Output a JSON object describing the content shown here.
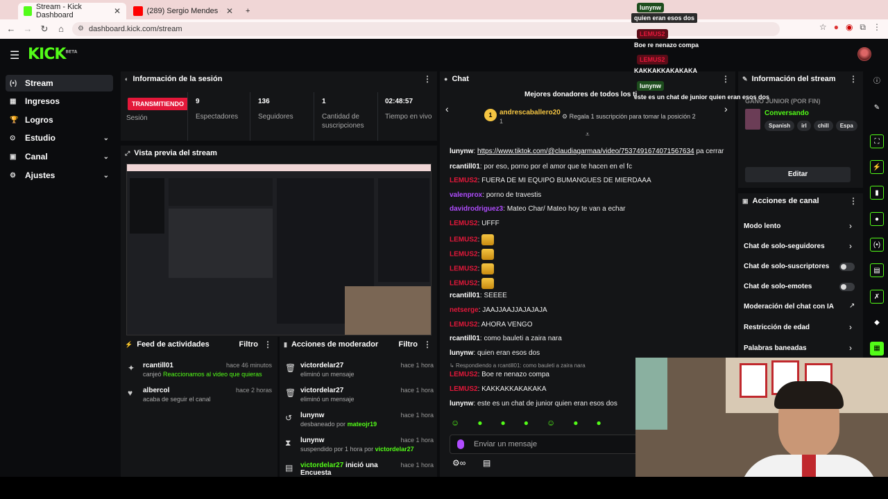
{
  "browser": {
    "tabs": [
      {
        "label": "Stream - Kick Dashboard",
        "icon": "kick-favicon"
      },
      {
        "label": "(289) Sergio Mendes - Mag",
        "icon": "youtube-favicon"
      }
    ],
    "url": "dashboard.kick.com/stream"
  },
  "header": {
    "logo": "KICK",
    "logo_sup": "BETA"
  },
  "sidebar": {
    "items": [
      {
        "label": "Stream",
        "icon": "stream-icon"
      },
      {
        "label": "Ingresos",
        "icon": "money-icon"
      },
      {
        "label": "Logros",
        "icon": "trophy-icon"
      },
      {
        "label": "Estudio",
        "icon": "studio-icon"
      },
      {
        "label": "Canal",
        "icon": "channel-icon"
      },
      {
        "label": "Ajustes",
        "icon": "gear-icon"
      }
    ]
  },
  "session": {
    "title": "Información de la sesión",
    "live_badge": "TRANSMITIENDO",
    "session_label": "Sesión",
    "stats": [
      {
        "value": "9",
        "label": "Espectadores"
      },
      {
        "value": "136",
        "label": "Seguidores"
      },
      {
        "value": "1",
        "label": "Cantidad de suscripciones"
      },
      {
        "value": "02:48:57",
        "label": "Tiempo en vivo"
      }
    ]
  },
  "preview": {
    "title": "Vista previa del stream"
  },
  "feed": {
    "title": "Feed de actividades",
    "filter": "Filtro",
    "items": [
      {
        "user": "rcantill01",
        "action": "canjeó",
        "highlight": "Reaccionamos al video que quieras",
        "time": "hace 46 minutos"
      },
      {
        "user": "albercol",
        "action": "acaba de seguir el canal",
        "highlight": "",
        "time": "hace 2 horas"
      }
    ]
  },
  "mod": {
    "title": "Acciones de moderador",
    "filter": "Filtro",
    "items": [
      {
        "user": "victordelar27",
        "desc": "eliminó un mensaje",
        "by": "",
        "time": "hace 1 hora"
      },
      {
        "user": "victordelar27",
        "desc": "eliminó un mensaje",
        "by": "",
        "time": "hace 1 hora"
      },
      {
        "user": "lunynw",
        "desc": "desbaneado por",
        "by": "mateojr19",
        "time": "hace 1 hora"
      },
      {
        "user": "lunynw",
        "desc": "suspendido por 1 hora por",
        "by": "victordelar27",
        "time": "hace 1 hora"
      },
      {
        "user": "victordelar27",
        "desc": "inició una Encuesta",
        "by": "",
        "time": "hace 1 hora"
      }
    ]
  },
  "chat": {
    "title": "Chat",
    "donors_title": "Mejores donadores de todos los ti",
    "top_donor": "andrescaballero20",
    "top_donor_count": "1",
    "gift_prompt": "Regala 1 suscripción para tomar la posición 2",
    "messages": [
      {
        "user": "lunynw",
        "color": "#ffffff",
        "text": "https://www.tiktok.com/@claudiagarmaa/video/7537491674071567634",
        "suffix": " pa cerrar",
        "link": true
      },
      {
        "user": "rcantill01",
        "color": "#ffffff",
        "text": "por eso, porno por el amor que te hacen en el fc"
      },
      {
        "user": "LEMUS2",
        "color": "#e3183a",
        "text": "FUERA DE MI EQUIPO BUMANGUES DE MIERDAAA"
      },
      {
        "user": "valenprox",
        "color": "#b04cff",
        "text": "porno de travestis"
      },
      {
        "user": "davidrodriguez3",
        "color": "#b04cff",
        "text": "Mateo Char/ Mateo hoy te van a echar"
      },
      {
        "user": "LEMUS2",
        "color": "#e3183a",
        "text": "UFFF"
      },
      {
        "user": "LEMUS2",
        "color": "#e3183a",
        "text": "",
        "emote": true
      },
      {
        "user": "LEMUS2",
        "color": "#e3183a",
        "text": "",
        "emote": true
      },
      {
        "user": "LEMUS2",
        "color": "#e3183a",
        "text": "",
        "emote": true
      },
      {
        "user": "LEMUS2",
        "color": "#e3183a",
        "text": "",
        "emote": true
      },
      {
        "user": "rcantill01",
        "color": "#ffffff",
        "text": "SEEEE"
      },
      {
        "user": "netserge",
        "color": "#e3183a",
        "text": "JAAJJAAJJAJAJAJA"
      },
      {
        "user": "LEMUS2",
        "color": "#e3183a",
        "text": "AHORA VENGO"
      },
      {
        "user": "rcantill01",
        "color": "#ffffff",
        "text": "como bauleti a zaira nara"
      },
      {
        "user": "lunynw",
        "color": "#ffffff",
        "text": "quien eran esos dos"
      },
      {
        "user": "LEMUS2",
        "color": "#e3183a",
        "text": "Boe re nenazo compa",
        "reply": "Respondiendo a rcantill01: como bauleti a zaira nara"
      },
      {
        "user": "LEMUS2",
        "color": "#e3183a",
        "text": "KAKKAKKAKAKAKA"
      },
      {
        "user": "lunynw",
        "color": "#ffffff",
        "text": "este es un chat de junior quien eran esos dos"
      }
    ],
    "input_placeholder": "Enviar un mensaje"
  },
  "stream_info": {
    "title": "Información del stream",
    "stream_title": "GANO JUNIOR (POR FIN)",
    "category": "Conversando",
    "tags": [
      "Spanish",
      "irl",
      "chill",
      "Espa"
    ],
    "edit": "Editar"
  },
  "channel_actions": {
    "title": "Acciones de canal",
    "items": [
      {
        "label": "Modo lento",
        "control": "arrow"
      },
      {
        "label": "Chat de solo-seguidores",
        "control": "arrow"
      },
      {
        "label": "Chat de solo-suscriptores",
        "control": "toggle"
      },
      {
        "label": "Chat de solo-emotes",
        "control": "toggle"
      },
      {
        "label": "Moderación del chat con IA",
        "control": "external"
      },
      {
        "label": "Restricción de edad",
        "control": "arrow"
      },
      {
        "label": "Palabras baneadas",
        "control": "arrow"
      }
    ]
  },
  "overlay": [
    {
      "user": "lunynw",
      "text": "quien eran esos dos"
    },
    {
      "user": "LEMUS2",
      "text": "Boe re nenazo compa"
    },
    {
      "user": "LEMUS2",
      "text": "KAKKAKKAKAKAKA"
    },
    {
      "user": "lunynw",
      "text": "este es un chat de junior quien eran esos dos"
    }
  ]
}
